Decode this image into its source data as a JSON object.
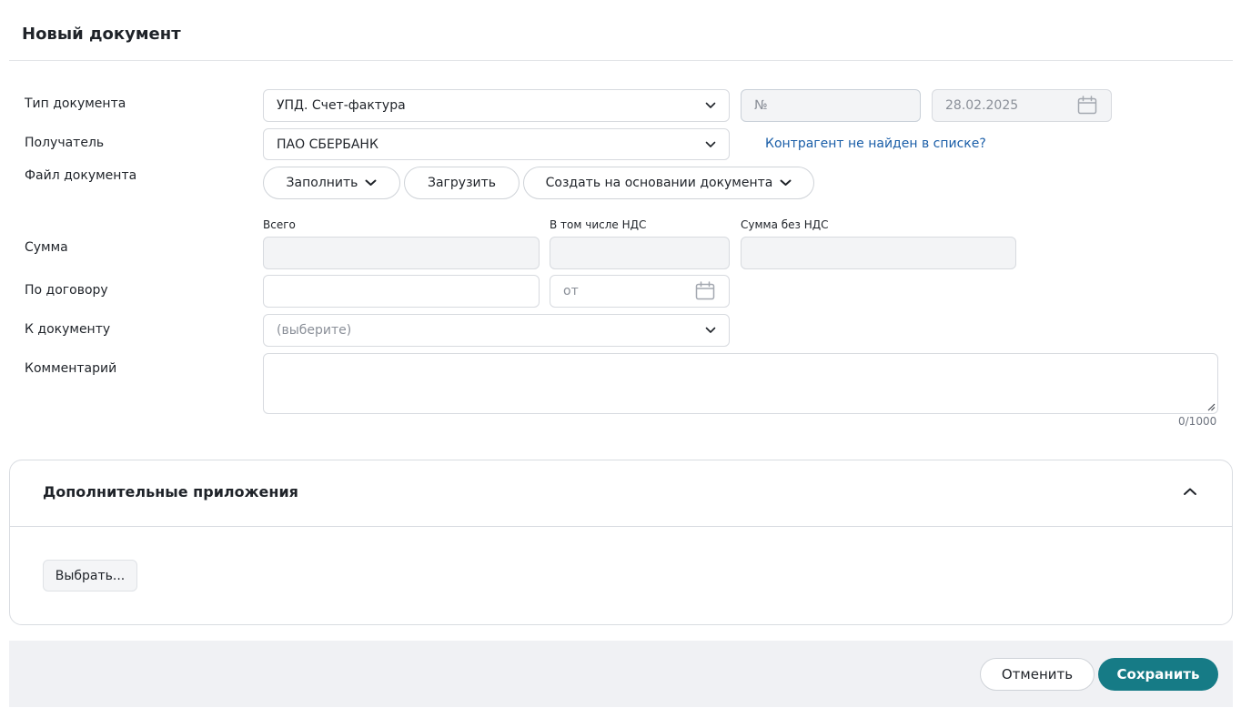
{
  "title": "Новый документ",
  "labels": {
    "doc_type": "Тип документа",
    "recipient": "Получатель",
    "doc_file": "Файл документа",
    "sum": "Сумма",
    "contract": "По договору",
    "to_document": "К документу",
    "comment": "Комментарий"
  },
  "doc_type": {
    "value": "УПД. Счет-фактура",
    "number_placeholder": "№",
    "date": "28.02.2025"
  },
  "recipient": {
    "value": "ПАО СБЕРБАНК",
    "not_found_link": "Контрагент не найден в списке?"
  },
  "file_buttons": {
    "fill": "Заполнить",
    "upload": "Загрузить",
    "create_based": "Создать на основании документа"
  },
  "sum": {
    "total_label": "Всего",
    "vat_label": "В том числе НДС",
    "without_vat_label": "Сумма без НДС"
  },
  "contract": {
    "date_placeholder": "от"
  },
  "to_document": {
    "placeholder": "(выберите)"
  },
  "comment": {
    "counter": "0/1000"
  },
  "attachments": {
    "title": "Дополнительные приложения",
    "choose_button": "Выбрать..."
  },
  "footer": {
    "cancel": "Отменить",
    "save": "Сохранить"
  },
  "colors": {
    "accent": "#167b86",
    "link": "#1a5ea8"
  }
}
